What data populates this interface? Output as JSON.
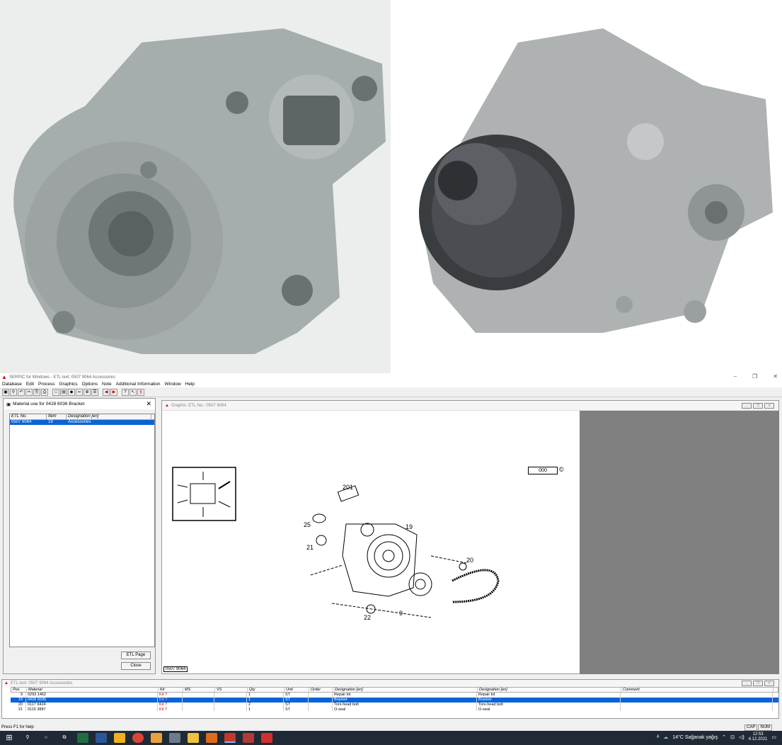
{
  "app": {
    "title": "SERPIC for Windows - ETL text: 0507 9064     Accessories",
    "win_controls": [
      "–",
      "❐",
      "✕"
    ]
  },
  "menu": [
    "Database",
    "Edit",
    "Process",
    "Graphics",
    "Options",
    "Note",
    "Additional Information",
    "Window",
    "Help"
  ],
  "dialog": {
    "title": "Material use for 0428 6036 Bracket",
    "columns": [
      "ETL No.",
      "Item",
      "Designation [en]"
    ],
    "rows": [
      {
        "etl": "0507 9064",
        "item": "19",
        "designation": "Accessories"
      }
    ],
    "etl_page_button": "ETL Page",
    "close_button": "Close"
  },
  "graphic": {
    "title": "Graphic: ETL No.: 0507 9064",
    "drawing_label": "0507 9064",
    "logo_text": "000",
    "copyright": "©",
    "callouts": [
      "201",
      "25",
      "19",
      "21",
      "20",
      "22",
      "9"
    ]
  },
  "etl": {
    "title": "ETL text: 0507 9064     Accessories",
    "columns": [
      "Pos",
      "Material",
      "Kit",
      "MS",
      "VS",
      "Qty",
      "Unit",
      "Order",
      "Designation [en]",
      "Designation [en]",
      "Comment"
    ],
    "rows": [
      {
        "pos": "9",
        "material": "0293 1462",
        "kit": "Kit ?",
        "qty": "1",
        "unit": "ST",
        "d1": "Repair kit",
        "d2": "Repair kit",
        "selected": false
      },
      {
        "pos": "19",
        "material": "0428 6036",
        "kit": "Kit ?",
        "qty": "1",
        "unit": "ST",
        "d1": "Bracket",
        "d2": "Bracket",
        "selected": true
      },
      {
        "pos": "20",
        "material": "0117 9424",
        "kit": "Kit ?",
        "qty": "2",
        "unit": "ST",
        "d1": "Torx-head bolt",
        "d2": "Torx-head bolt",
        "selected": false
      },
      {
        "pos": "21",
        "material": "0115 3887",
        "kit": "Kit ?",
        "qty": "1",
        "unit": "ST",
        "d1": "O-seal",
        "d2": "O-seal",
        "selected": false
      }
    ]
  },
  "status": {
    "help": "Press F1 for help",
    "cap": "CAP",
    "num": "NUM"
  },
  "taskbar": {
    "weather": "14°C  Sağanak yağış",
    "time": "12:53",
    "date": "4.12.2021"
  }
}
